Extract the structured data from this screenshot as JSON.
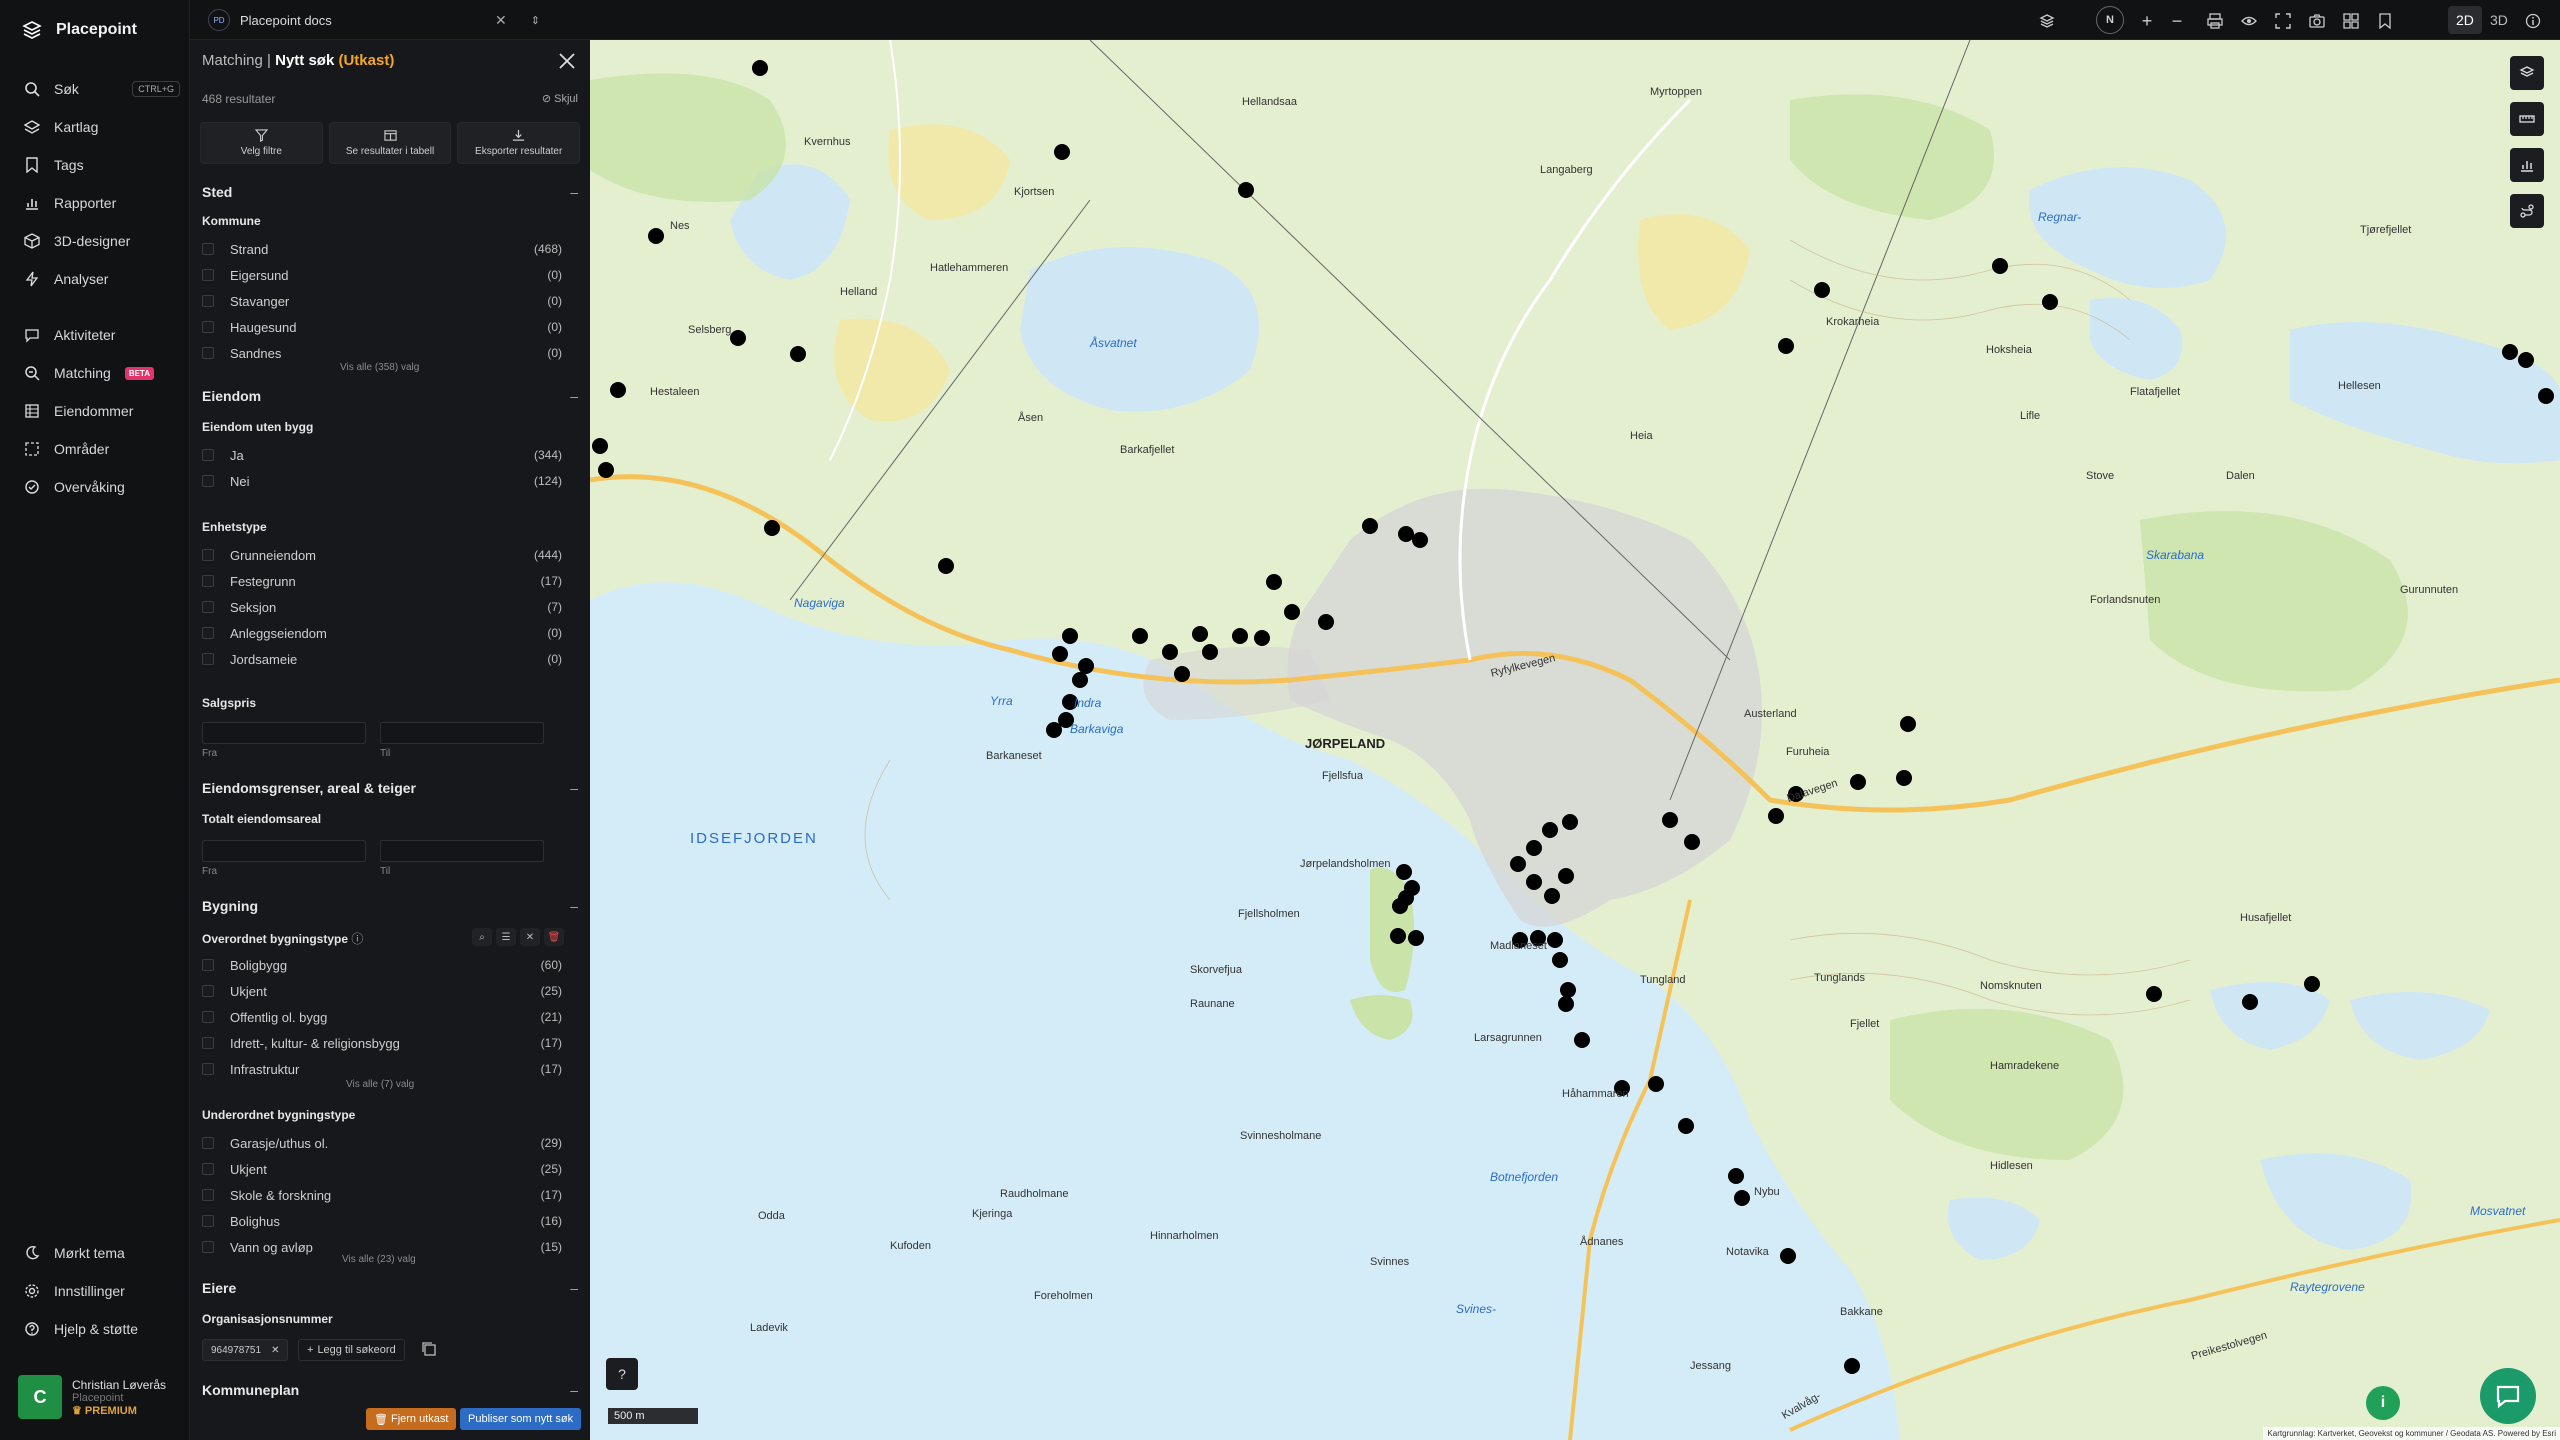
{
  "brand": {
    "name": "Placepoint"
  },
  "nav": {
    "items": [
      {
        "label": "Søk",
        "kbd": "CTRL+G"
      },
      {
        "label": "Kartlag"
      },
      {
        "label": "Tags"
      },
      {
        "label": "Rapporter"
      },
      {
        "label": "3D-designer"
      },
      {
        "label": "Analyser"
      },
      {
        "label": "Aktiviteter"
      },
      {
        "label": "Matching",
        "badge": "BETA"
      },
      {
        "label": "Eiendommer"
      },
      {
        "label": "Områder"
      },
      {
        "label": "Overvåking"
      }
    ],
    "bottom": [
      {
        "label": "Mørkt tema"
      },
      {
        "label": "Innstillinger"
      },
      {
        "label": "Hjelp & støtte"
      }
    ],
    "user": {
      "initial": "C",
      "name": "Christian Løverås",
      "company": "Placepoint",
      "plan": "PREMIUM"
    }
  },
  "topbar": {
    "doc_badge": "PD",
    "doc_title": "Placepoint docs",
    "mode_2d": "2D",
    "mode_3d": "3D",
    "north": "N"
  },
  "panel": {
    "crumb_parent": "Matching",
    "crumb_sep": "|",
    "crumb_current": "Nytt søk",
    "crumb_status": "(Utkast)",
    "result_count": "468 resultater",
    "hide_label": "Skjul",
    "actions": [
      "Velg filtre",
      "Se resultater i tabell",
      "Eksporter resultater"
    ],
    "sted": {
      "title": "Sted",
      "kommune_label": "Kommune",
      "rows": [
        {
          "label": "Strand",
          "value": "(468)"
        },
        {
          "label": "Eigersund",
          "value": "(0)"
        },
        {
          "label": "Stavanger",
          "value": "(0)"
        },
        {
          "label": "Haugesund",
          "value": "(0)"
        },
        {
          "label": "Sandnes",
          "value": "(0)"
        }
      ],
      "see_all": "Vis alle (358) valg"
    },
    "eiendom": {
      "title": "Eiendom",
      "uten_bygg_label": "Eiendom uten bygg",
      "uten_bygg": [
        {
          "label": "Ja",
          "value": "(344)"
        },
        {
          "label": "Nei",
          "value": "(124)"
        }
      ],
      "enhetstype_label": "Enhetstype",
      "enhetstype": [
        {
          "label": "Grunneiendom",
          "value": "(444)"
        },
        {
          "label": "Festegrunn",
          "value": "(17)"
        },
        {
          "label": "Seksjon",
          "value": "(7)"
        },
        {
          "label": "Anleggseiendom",
          "value": "(0)"
        },
        {
          "label": "Jordsameie",
          "value": "(0)"
        }
      ],
      "salgspris_label": "Salgspris",
      "from": "Fra",
      "to": "Til"
    },
    "grenser": {
      "title": "Eiendomsgrenser, areal & teiger",
      "areal_label": "Totalt eiendomsareal",
      "from": "Fra",
      "to": "Til"
    },
    "bygning": {
      "title": "Bygning",
      "overordnet_label": "Overordnet bygningstype",
      "overordnet": [
        {
          "label": "Boligbygg",
          "value": "(60)"
        },
        {
          "label": "Ukjent",
          "value": "(25)"
        },
        {
          "label": "Offentlig ol. bygg",
          "value": "(21)"
        },
        {
          "label": "Idrett-, kultur- & religionsbygg",
          "value": "(17)"
        },
        {
          "label": "Infrastruktur",
          "value": "(17)"
        }
      ],
      "overordnet_see_all": "Vis alle (7) valg",
      "underordnet_label": "Underordnet bygningstype",
      "underordnet": [
        {
          "label": "Garasje/uthus ol.",
          "value": "(29)"
        },
        {
          "label": "Ukjent",
          "value": "(25)"
        },
        {
          "label": "Skole & forskning",
          "value": "(17)"
        },
        {
          "label": "Bolighus",
          "value": "(16)"
        },
        {
          "label": "Vann og avløp",
          "value": "(15)"
        }
      ],
      "underordnet_see_all": "Vis alle (23) valg"
    },
    "eiere": {
      "title": "Eiere",
      "org_label": "Organisasjonsnummer",
      "chip": "964978751",
      "add_keyword": "Legg til søkeord"
    },
    "kommuneplan": {
      "title": "Kommuneplan"
    },
    "remove_draft": "Fjern utkast",
    "publish": "Publiser som nytt søk"
  },
  "map": {
    "scale": "500 m",
    "attribution": "Kartgrunnlag: Kartverket, Geovekst og kommuner / Geodata AS. Powered by Esri",
    "labels": [
      "JØRPELAND",
      "IDSEFJORDEN",
      "Ryfylkevegen",
      "Dalavegen",
      "Preikestolvegen",
      "Åsvatnet",
      "Regnar-",
      "Botnefjorden",
      "Barkaneset",
      "Fjellsfua",
      "Jørpelandsholmen",
      "Fjellsholmen",
      "Skorvefjua",
      "Raunane",
      "Madlaneset",
      "Håhammaren",
      "Larsagrunnen",
      "Svinnesholmane",
      "Raudholmane",
      "Kjeringa",
      "Hinnarholmen",
      "Odda",
      "Kufoden",
      "Foreholmen",
      "Ladevik",
      "Svinnes",
      "Svines-",
      "Nybu",
      "Notavika",
      "Ådnanes",
      "Bakkane",
      "Jessang",
      "Tungland",
      "Tunglands",
      "Nomsknuten",
      "Hamradekene",
      "Husafjellet",
      "Hidlesen",
      "Fjellet",
      "Furuheia",
      "Austerland",
      "Heia",
      "Nes",
      "Helland",
      "Selsberg",
      "Hestaleen",
      "Hatlehammeren",
      "Kvernhus",
      "Nagaviga",
      "Yrra",
      "Barkaviga",
      "Indra",
      "Åsen",
      "Barkafjellet",
      "Kjortsen",
      "Hellandsaa",
      "Myrtoppen",
      "Langaberg",
      "Krokarheia",
      "Lifle",
      "Stove",
      "Dalen",
      "Flatafjellet",
      "Hoksheia",
      "Hellesen",
      "Forlandsnuten",
      "Skarabana",
      "Tjørefjellet",
      "Gurunnuten",
      "Mosvatnet",
      "Raytegrovene",
      "Kvalvåg-"
    ]
  }
}
